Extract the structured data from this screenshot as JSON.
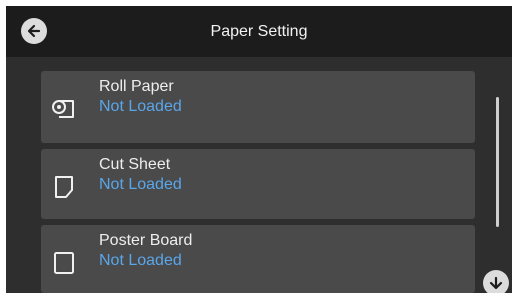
{
  "header": {
    "title": "Paper Setting",
    "back_icon": "arrow-left-icon"
  },
  "items": [
    {
      "name": "Roll Paper",
      "status": "Not Loaded",
      "icon": "roll-paper-icon"
    },
    {
      "name": "Cut Sheet",
      "status": "Not Loaded",
      "icon": "cut-sheet-icon"
    },
    {
      "name": "Poster Board",
      "status": "Not Loaded",
      "icon": "poster-board-icon"
    }
  ],
  "scroll": {
    "down_icon": "arrow-down-icon"
  },
  "colors": {
    "status": "#5aa6ea",
    "item_background": "#4a4a4a",
    "header_background": "#1c1c1c"
  }
}
